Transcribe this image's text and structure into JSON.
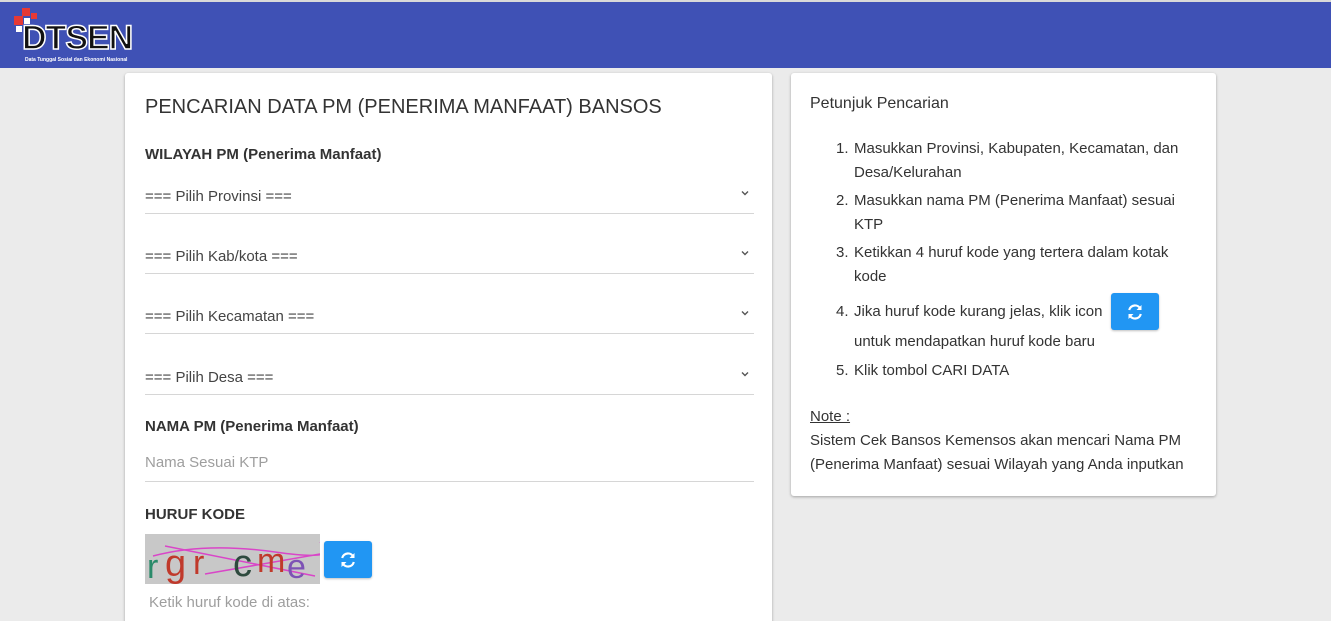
{
  "header": {
    "logo_text": "DTSEN",
    "logo_subtitle": "Data Tunggal Sosial dan Ekonomi Nasional",
    "bg_color": "#3f51b5"
  },
  "form": {
    "title": "PENCARIAN DATA PM (PENERIMA MANFAAT) BANSOS",
    "wilayah_label": "WILAYAH PM (Penerima Manfaat)",
    "selects": [
      {
        "value": "=== Pilih Provinsi ==="
      },
      {
        "value": "=== Pilih Kab/kota ==="
      },
      {
        "value": "=== Pilih Kecamatan ==="
      },
      {
        "value": "=== Pilih Desa ==="
      }
    ],
    "nama_label": "NAMA PM (Penerima Manfaat)",
    "nama_placeholder": "Nama Sesuai KTP",
    "kode_label": "HURUF KODE",
    "captcha_text": "rgrcme",
    "kode_placeholder": "Ketik huruf kode di atas:",
    "refresh_icon": "refresh-icon",
    "accent_color": "#2196f3"
  },
  "guide": {
    "title": "Petunjuk Pencarian",
    "steps": [
      "Masukkan Provinsi, Kabupaten, Kecamatan, dan Desa/Kelurahan",
      "Masukkan nama PM (Penerima Manfaat) sesuai KTP",
      "Ketikkan 4 huruf kode yang tertera dalam kotak kode",
      "Jika huruf kode kurang jelas, klik icon",
      "Klik tombol CARI DATA"
    ],
    "step4_suffix": "untuk mendapatkan huruf kode baru",
    "note_label": "Note :",
    "note_text": "Sistem Cek Bansos Kemensos akan mencari Nama PM (Penerima Manfaat) sesuai Wilayah yang Anda inputkan"
  }
}
